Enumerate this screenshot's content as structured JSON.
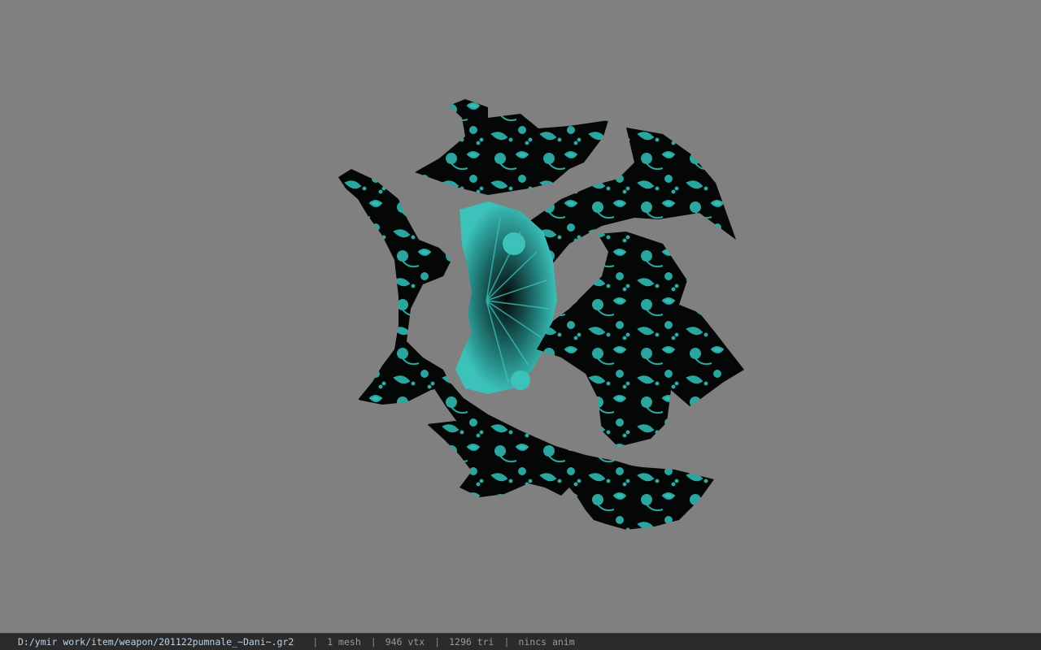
{
  "viewport": {
    "background": "#808080",
    "model_name": "pumnale",
    "texture_colors": {
      "base": "#050606",
      "pattern": "#2aa5a0",
      "highlight": "#5ad4cc"
    }
  },
  "status_bar": {
    "file_path": "D:/ymir work/item/weapon/201122pumnale_~Dani~.gr2",
    "separator": "|",
    "mesh_count": "1 mesh",
    "vertex_count": "946 vtx",
    "triangle_count": "1296 tri",
    "anim_status": "nincs anim"
  }
}
